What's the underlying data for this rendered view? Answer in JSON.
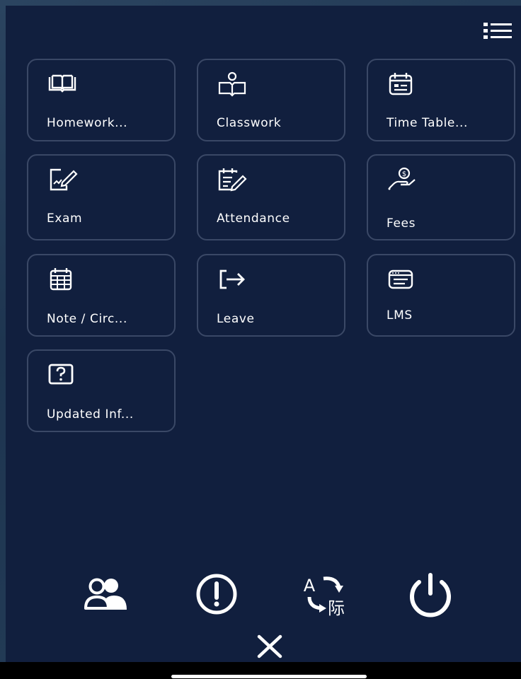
{
  "tiles": [
    {
      "label": "Homework...",
      "icon": "book-open-icon"
    },
    {
      "label": "Classwork",
      "icon": "person-reading-icon"
    },
    {
      "label": "Time Table...",
      "icon": "calendar-schedule-icon"
    },
    {
      "label": "Exam",
      "icon": "exam-paper-pen-icon"
    },
    {
      "label": "Attendance",
      "icon": "attendance-list-pen-icon"
    },
    {
      "label": "Fees",
      "icon": "hand-coin-icon"
    },
    {
      "label": "Note / Circ...",
      "icon": "calendar-grid-icon"
    },
    {
      "label": "Leave",
      "icon": "exit-arrow-icon"
    },
    {
      "label": "LMS",
      "icon": "browser-window-icon"
    },
    {
      "label": "Updated Inf...",
      "icon": "question-box-icon"
    }
  ],
  "bottom_actions": [
    {
      "name": "users-icon"
    },
    {
      "name": "alert-circle-icon"
    },
    {
      "name": "translate-icon",
      "glyph_top": "A",
      "glyph_bottom": "际"
    },
    {
      "name": "power-icon"
    }
  ],
  "close": {
    "name": "close-icon"
  },
  "header": {
    "menu_icon": "list-menu-icon"
  },
  "colors": {
    "panel": "#111f3e",
    "tile_border": "#3a4866",
    "text": "#ffffff"
  }
}
